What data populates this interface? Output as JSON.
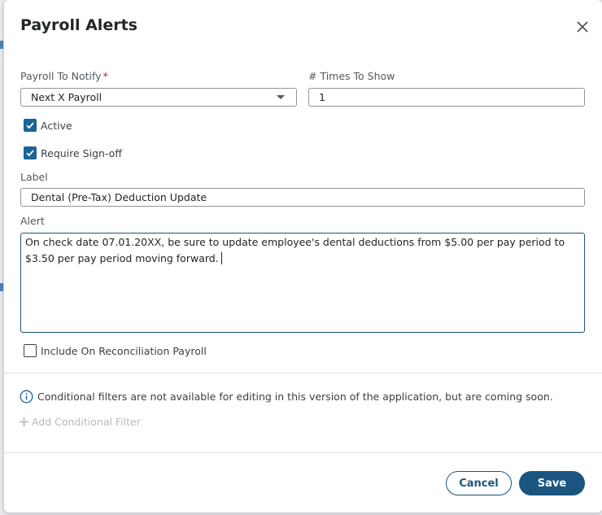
{
  "dialog": {
    "title": "Payroll Alerts",
    "close_icon": "close-icon"
  },
  "form": {
    "payroll_to_notify": {
      "label": "Payroll To Notify",
      "required_mark": "*",
      "value": "Next X Payroll"
    },
    "times_to_show": {
      "label": "# Times To Show",
      "value": "1"
    },
    "active": {
      "label": "Active",
      "checked": true
    },
    "require_signoff": {
      "label": "Require Sign-off",
      "checked": true
    },
    "label_field": {
      "label": "Label",
      "value": "Dental (Pre-Tax) Deduction Update"
    },
    "alert_field": {
      "label": "Alert",
      "value": "On check date 07.01.20XX, be sure to update employee's dental deductions from $5.00 per pay period to $3.50 per pay period moving forward."
    },
    "include_reconciliation": {
      "label": "Include On Reconciliation Payroll",
      "checked": false
    }
  },
  "conditional": {
    "info_text": "Conditional filters are not available for editing in this version of the application, but are coming soon.",
    "add_filter_label": "Add Conditional Filter"
  },
  "footer": {
    "cancel_label": "Cancel",
    "save_label": "Save"
  },
  "colors": {
    "primary": "#1a5580",
    "checkbox": "#1a6496",
    "required": "#c8102e",
    "disabled_text": "#b5babe"
  }
}
